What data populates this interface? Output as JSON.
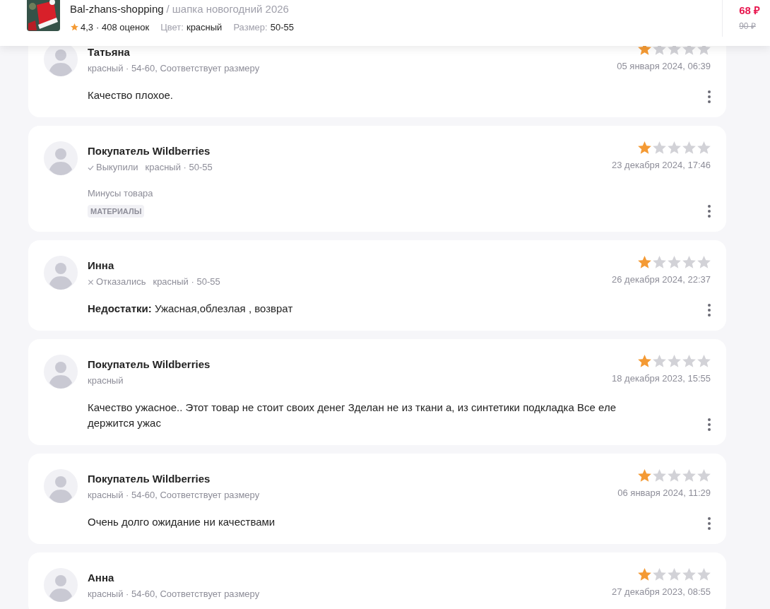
{
  "header": {
    "shop": "Bal-zhans-shopping",
    "separator": "/",
    "product": "шапка новогодний 2026",
    "rating": "4,3",
    "rating_count": "· 408 оценок",
    "color_label": "Цвет:",
    "color_value": "красный",
    "size_label": "Размер:",
    "size_value": "50-55",
    "price": "68 ₽",
    "old_price": "90 ₽"
  },
  "reviews": [
    {
      "name": "Татьяна",
      "details": "красный · 54-60, Соответствует размеру",
      "date": "05 января 2024, 06:39",
      "stars": 1,
      "body": {
        "kind": "text",
        "text": "Качество плохое."
      }
    },
    {
      "name": "Покупатель Wildberries",
      "status": {
        "kind": "bought",
        "label": "Выкупили"
      },
      "details": "красный · 50-55",
      "date": "23 декабря 2024, 17:46",
      "stars": 1,
      "body": {
        "kind": "tags",
        "label": "Минусы товара",
        "tags": [
          "МАТЕРИАЛЫ"
        ]
      }
    },
    {
      "name": "Инна",
      "status": {
        "kind": "refused",
        "label": "Отказались"
      },
      "details": "красный · 50-55",
      "date": "26 декабря 2024, 22:37",
      "stars": 1,
      "body": {
        "kind": "text",
        "text": "**Недостатки:** Ужасная,облезлая , возврат"
      }
    },
    {
      "name": "Покупатель Wildberries",
      "details": "красный",
      "date": "18 декабря 2023, 15:55",
      "stars": 1,
      "body": {
        "kind": "text",
        "text": "Качество ужасное.. Этот товар не стоит своих денег Зделан не из ткани а, из синтетики подкладка Все еле держится ужас"
      }
    },
    {
      "name": "Покупатель Wildberries",
      "details": "красный · 54-60, Соответствует размеру",
      "date": "06 января 2024, 11:29",
      "stars": 1,
      "body": {
        "kind": "text",
        "text": "Очень долго ожидание ни качествами"
      }
    },
    {
      "name": "Анна",
      "details": "красный · 54-60, Соответствует размеру",
      "date": "27 декабря 2023, 08:55",
      "stars": 1
    }
  ]
}
